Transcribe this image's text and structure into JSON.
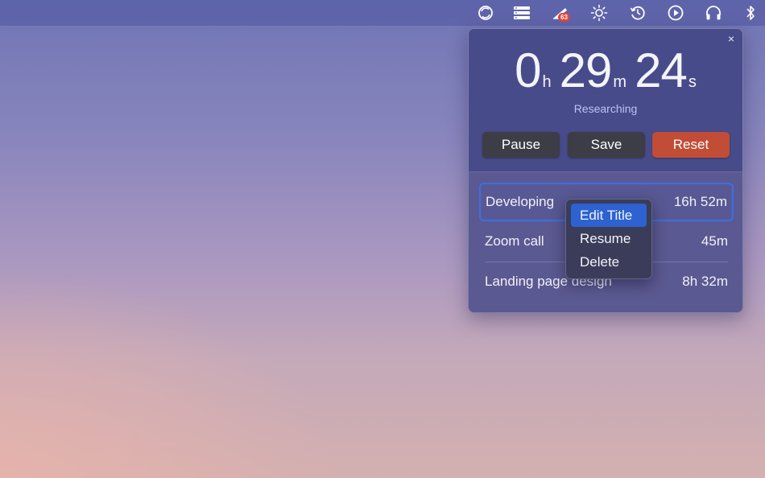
{
  "menubar": {
    "icons": [
      {
        "name": "sync-circle-icon"
      },
      {
        "name": "stack-icon"
      },
      {
        "name": "app-badge-icon",
        "badge": "63"
      },
      {
        "name": "brightness-icon"
      },
      {
        "name": "history-icon"
      },
      {
        "name": "play-circle-icon"
      },
      {
        "name": "headphones-icon"
      },
      {
        "name": "bluetooth-icon"
      }
    ]
  },
  "timer": {
    "hours": "0",
    "hours_unit": "h",
    "minutes": "29",
    "minutes_unit": "m",
    "seconds": "24",
    "seconds_unit": "s",
    "activity": "Researching",
    "close_label": "×"
  },
  "buttons": {
    "pause": "Pause",
    "save": "Save",
    "reset": "Reset"
  },
  "entries": [
    {
      "title": "Developing",
      "duration": "16h 52m"
    },
    {
      "title": "Zoom call",
      "duration": "45m"
    },
    {
      "title": "Landing page design",
      "duration": "8h 32m"
    }
  ],
  "context_menu": {
    "items": [
      "Edit Title",
      "Resume",
      "Delete"
    ]
  },
  "colors": {
    "accent": "#2d62d0",
    "reset": "#c14d36",
    "badge": "#e0463b"
  }
}
